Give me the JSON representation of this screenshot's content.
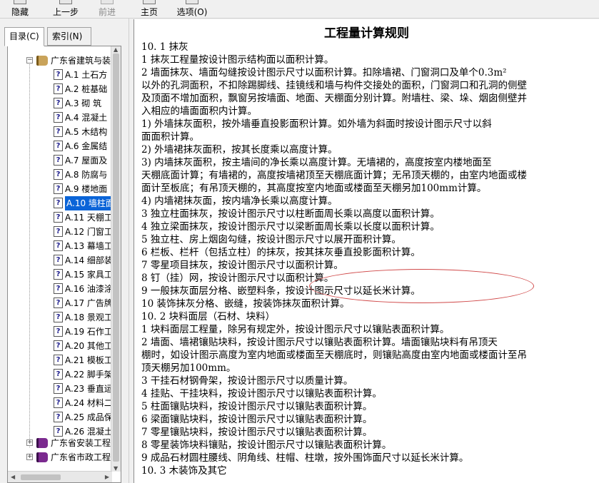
{
  "toolbar": {
    "hide": "隐藏",
    "back": "上一步",
    "forward": "前进",
    "home": "主页",
    "options": "选项(O)"
  },
  "tabs": {
    "contents": "目录(C)",
    "index": "索引(N)"
  },
  "tree": {
    "root_label": "广东省建筑与装",
    "items": [
      "A.1 土石方",
      "A.2 桩基础",
      "A.3 砌 筑",
      "A.4 混凝土",
      "A.5 木结构",
      "A.6 金属结",
      "A.7 屋面及",
      "A.8 防腐与",
      "A.9 楼地面",
      "A.10 墙柱面",
      "A.11 天棚工",
      "A.12 门窗工",
      "A.13 幕墙工",
      "A.14 细部装",
      "A.15 家具工",
      "A.16 油漆涂",
      "A.17 广告牌",
      "A.18 景观工",
      "A.19 石作工",
      "A.20 其他工",
      "A.21 模板工",
      "A.22 脚手架",
      "A.23 垂直运",
      "A.24 材料二",
      "A.25 成品保",
      "A.26 混凝土"
    ],
    "selected_index": 9,
    "sibling_books": [
      "广东省安装工程",
      "广东省市政工程"
    ]
  },
  "document": {
    "title": "工程量计算规则",
    "lines": [
      "10. 1  抹灰",
      "   1  抹灰工程量按设计图示结构面以面积计算。",
      "   2  墙面抹灰、墙面勾缝按设计图示尺寸以面积计算。扣除墙裙、门窗洞口及单个0.3m²",
      "以外的孔洞面积，不扣除踢脚线、挂镜线和墙与构件交接处的面积，门窗洞口和孔洞的侧壁",
      "及顶面不增加面积，飘窗另按墙面、地面、天棚面分别计算。附墙柱、梁、垛、烟囱侧壁并",
      "入相应的墙面面积内计算。",
      "   1)   外墙抹灰面积，按外墙垂直投影面积计算。如外墙为斜面时按设计图示尺寸以斜",
      "面面积计算。",
      "   2)   外墙裙抹灰面积，按其长度乘以高度计算。",
      "   3)   内墙抹灰面积，按主墙间的净长乘以高度计算。无墙裙的，高度按室内楼地面至",
      "天棚底面计算；有墙裙的，高度按墙裙顶至天棚底面计算；无吊顶天棚的，由室内地面或楼",
      "面计至板底；有吊顶天棚的，其高度按室内地面或楼面至天棚另加100mm计算。",
      "   4)   内墙裙抹灰面，按内墙净长乘以高度计算。",
      "   3  独立柱面抹灰，按设计图示尺寸以柱断面周长乘以高度以面积计算。",
      "   4  独立梁面抹灰，按设计图示尺寸以梁断面周长乘以长度以面积计算。",
      "   5  独立柱、房上烟囱勾缝，按设计图示尺寸以展开面积计算。",
      "   6  栏板、栏杆（包括立柱）的抹灰，按其抹灰垂直投影面积计算。",
      "   7  零星项目抹灰，按设计图示尺寸以面积计算。",
      "   8  钉（挂）网，按设计图示尺寸以面积计算。",
      "   9  一般抹灰面层分格、嵌塑料条，按设计图示尺寸以延长米计算。",
      "   10  装饰抹灰分格、嵌缝，按装饰抹灰面积计算。",
      "10. 2  块料面层（石材、块料）",
      "   1  块料面层工程量，除另有规定外，按设计图示尺寸以镶贴表面积计算。",
      "   2  墙面、墙裙镶贴块料，按设计图示尺寸以镶贴表面积计算。墙面镶贴块料有吊顶天",
      "棚时，如设计图示高度为室内地面或楼面至天棚底时，则镶贴高度由室内地面或楼面计至吊",
      "顶天棚另加100mm。",
      "   3  干挂石材钢骨架，按设计图示尺寸以质量计算。",
      "   4  挂贴、干挂块料，按设计图示尺寸以镶贴表面积计算。",
      "   5  柱面镶贴块料，按设计图示尺寸以镶贴表面积计算。",
      "   6  梁面镶贴块料，按设计图示尺寸以镶贴表面积计算。",
      "   7  零星镶贴块料，按设计图示尺寸以镶贴表面积计算。",
      "   8  零星装饰块料镶贴，按设计图示尺寸以镶贴表面积计算。",
      "   9  成品石材圆柱腰线、阴角线、柱帽、柱墩，按外围饰面尺寸以延长米计算。",
      "10. 3  木装饰及其它"
    ]
  }
}
